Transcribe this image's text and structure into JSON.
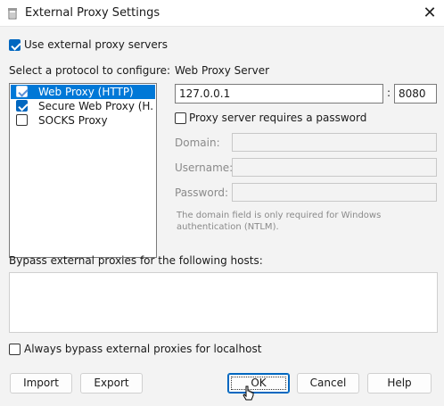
{
  "window": {
    "title": "External Proxy Settings",
    "close_glyph": "✕"
  },
  "use_external": {
    "label": "Use external proxy servers",
    "checked": true
  },
  "protocols": {
    "heading": "Select a protocol to configure:",
    "items": [
      {
        "label": "Web Proxy (HTTP)",
        "checked": true,
        "selected": true
      },
      {
        "label": "Secure Web Proxy (H...",
        "checked": true,
        "selected": false
      },
      {
        "label": "SOCKS Proxy",
        "checked": false,
        "selected": false
      }
    ]
  },
  "server": {
    "heading": "Web Proxy Server",
    "host": "127.0.0.1",
    "colon": ":",
    "port": "8080",
    "password_required_label": "Proxy server requires a password",
    "password_required": false,
    "domain_label": "Domain:",
    "username_label": "Username:",
    "password_label": "Password:",
    "note": "The domain field is only required for Windows authentication (NTLM)."
  },
  "bypass": {
    "label": "Bypass external proxies for the following hosts:",
    "value": ""
  },
  "localhost": {
    "label": "Always bypass external proxies for localhost",
    "checked": false
  },
  "buttons": {
    "import": "Import",
    "export": "Export",
    "ok": "OK",
    "cancel": "Cancel",
    "help": "Help"
  },
  "colors": {
    "accent": "#0067c0",
    "selection": "#0078d7"
  }
}
